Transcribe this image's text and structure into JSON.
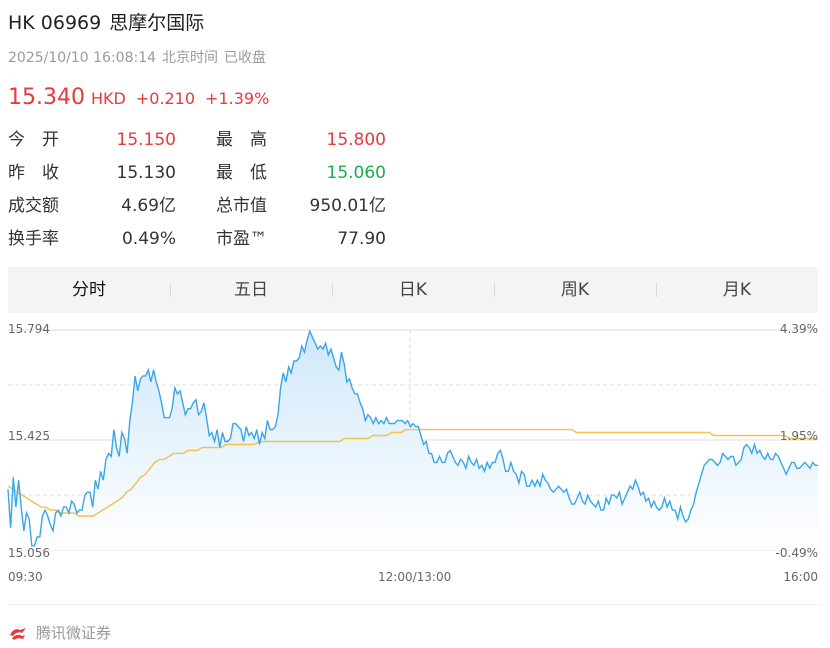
{
  "header": {
    "code": "HK 06969",
    "name": "思摩尔国际",
    "datetime": "2025/10/10 16:08:14",
    "timezone": "北京时间",
    "market_status": "已收盘"
  },
  "quote": {
    "price": "15.340",
    "currency": "HKD",
    "change": "+0.210",
    "change_pct": "+1.39%"
  },
  "stats": [
    {
      "label": "今　开",
      "value": "15.150",
      "tone": "red"
    },
    {
      "label": "最　高",
      "value": "15.800",
      "tone": "red"
    },
    {
      "label": "昨　收",
      "value": "15.130",
      "tone": "dark"
    },
    {
      "label": "最　低",
      "value": "15.060",
      "tone": "green"
    },
    {
      "label": "成交额",
      "value": "4.69亿",
      "tone": "dark"
    },
    {
      "label": "总市值",
      "value": "950.01亿",
      "tone": "dark"
    },
    {
      "label": "换手率",
      "value": "0.49%",
      "tone": "dark"
    },
    {
      "label": "市盈™",
      "value": "77.90",
      "tone": "dark"
    }
  ],
  "tabs": [
    {
      "label": "分时",
      "active": true
    },
    {
      "label": "五日",
      "active": false
    },
    {
      "label": "日K",
      "active": false
    },
    {
      "label": "周K",
      "active": false
    },
    {
      "label": "月K",
      "active": false
    }
  ],
  "chart_data": {
    "type": "area",
    "x_ticks": [
      "09:30",
      "12:00/13:00",
      "16:00"
    ],
    "y_left_ticks": [
      "15.794",
      "15.425",
      "15.056"
    ],
    "y_right_ticks": [
      "4.39%",
      "1.95%",
      "-0.49%"
    ],
    "ylim": [
      15.056,
      15.794
    ],
    "prev_close": 15.13,
    "grid": true,
    "colors": {
      "price_line": "#3aa6e8",
      "avg_line": "#f2c14e",
      "fill_top": "#cfe8fa",
      "grid": "#dddddd"
    },
    "series": [
      {
        "values": [
          15.26,
          15.13,
          15.3,
          15.2,
          15.29,
          15.2,
          15.12,
          15.18,
          15.16,
          15.07,
          15.07,
          15.1,
          15.1,
          15.17,
          15.19,
          15.17,
          15.14,
          15.12,
          15.18,
          15.19,
          15.17,
          15.2,
          15.2,
          15.18,
          15.22,
          15.21,
          15.18,
          15.19,
          15.19,
          15.24,
          15.25,
          15.25,
          15.2,
          15.29,
          15.26,
          15.32,
          15.29,
          15.36,
          15.38,
          15.37,
          15.46,
          15.4,
          15.37,
          15.45,
          15.43,
          15.38,
          15.49,
          15.55,
          15.64,
          15.59,
          15.63,
          15.64,
          15.64,
          15.66,
          15.62,
          15.66,
          15.62,
          15.59,
          15.55,
          15.5,
          15.5,
          15.5,
          15.53,
          15.6,
          15.58,
          15.59,
          15.55,
          15.51,
          15.53,
          15.53,
          15.55,
          15.56,
          15.51,
          15.52,
          15.55,
          15.5,
          15.44,
          15.45,
          15.42,
          15.46,
          15.4,
          15.45,
          15.42,
          15.42,
          15.43,
          15.48,
          15.48,
          15.47,
          15.46,
          15.42,
          15.47,
          15.44,
          15.45,
          15.43,
          15.46,
          15.41,
          15.45,
          15.43,
          15.49,
          15.46,
          15.46,
          15.47,
          15.51,
          15.6,
          15.65,
          15.62,
          15.67,
          15.65,
          15.69,
          15.69,
          15.7,
          15.74,
          15.72,
          15.76,
          15.79,
          15.77,
          15.75,
          15.73,
          15.74,
          15.73,
          15.75,
          15.71,
          15.73,
          15.7,
          15.67,
          15.66,
          15.72,
          15.68,
          15.62,
          15.63,
          15.6,
          15.58,
          15.58,
          15.55,
          15.53,
          15.49,
          15.51,
          15.5,
          15.48,
          15.5,
          15.48,
          15.49,
          15.48,
          15.5,
          15.48,
          15.48,
          15.48,
          15.49,
          15.49,
          15.49,
          15.48,
          15.49,
          15.47,
          15.48,
          15.47,
          15.47,
          15.44,
          15.41,
          15.42,
          15.38,
          15.38,
          15.35,
          15.35,
          15.37,
          15.35,
          15.35,
          15.38,
          15.39,
          15.37,
          15.35,
          15.34,
          15.36,
          15.35,
          15.33,
          15.37,
          15.35,
          15.34,
          15.36,
          15.33,
          15.34,
          15.32,
          15.35,
          15.33,
          15.35,
          15.35,
          15.38,
          15.39,
          15.36,
          15.32,
          15.32,
          15.35,
          15.32,
          15.31,
          15.28,
          15.32,
          15.31,
          15.27,
          15.27,
          15.29,
          15.27,
          15.29,
          15.27,
          15.31,
          15.29,
          15.28,
          15.26,
          15.25,
          15.26,
          15.27,
          15.26,
          15.25,
          15.26,
          15.23,
          15.21,
          15.21,
          15.23,
          15.25,
          15.22,
          15.21,
          15.24,
          15.22,
          15.21,
          15.2,
          15.22,
          15.19,
          15.19,
          15.23,
          15.21,
          15.24,
          15.24,
          15.23,
          15.25,
          15.21,
          15.23,
          15.25,
          15.27,
          15.26,
          15.29,
          15.27,
          15.24,
          15.25,
          15.22,
          15.23,
          15.2,
          15.22,
          15.2,
          15.19,
          15.2,
          15.23,
          15.2,
          15.22,
          15.19,
          15.19,
          15.16,
          15.2,
          15.17,
          15.15,
          15.16,
          15.19,
          15.21,
          15.25,
          15.28,
          15.31,
          15.34,
          15.35,
          15.36,
          15.36,
          15.35,
          15.34,
          15.35,
          15.38,
          15.37,
          15.36,
          15.37,
          15.37,
          15.34,
          15.35,
          15.36,
          15.4,
          15.41,
          15.4,
          15.38,
          15.41,
          15.38,
          15.39,
          15.37,
          15.36,
          15.38,
          15.36,
          15.36,
          15.38,
          15.37,
          15.35,
          15.33,
          15.31,
          15.33,
          15.35,
          15.35,
          15.33,
          15.33,
          15.34,
          15.35,
          15.34,
          15.33,
          15.35,
          15.34,
          15.34
        ]
      },
      {
        "values": [
          15.27,
          15.26,
          15.25,
          15.24,
          15.23,
          15.22,
          15.21,
          15.2,
          15.2,
          15.19,
          15.19,
          15.18,
          15.18,
          15.18,
          15.18,
          15.17,
          15.17,
          15.17,
          15.17,
          15.18,
          15.19,
          15.2,
          15.21,
          15.22,
          15.23,
          15.25,
          15.26,
          15.28,
          15.3,
          15.31,
          15.33,
          15.35,
          15.36,
          15.36,
          15.37,
          15.38,
          15.38,
          15.38,
          15.39,
          15.39,
          15.39,
          15.4,
          15.4,
          15.4,
          15.4,
          15.4,
          15.41,
          15.41,
          15.41,
          15.41,
          15.41,
          15.41,
          15.41,
          15.42,
          15.42,
          15.42,
          15.42,
          15.42,
          15.42,
          15.42,
          15.42,
          15.42,
          15.42,
          15.42,
          15.42,
          15.42,
          15.42,
          15.42,
          15.42,
          15.42,
          15.42,
          15.43,
          15.43,
          15.43,
          15.43,
          15.43,
          15.43,
          15.44,
          15.44,
          15.44,
          15.44,
          15.45,
          15.45,
          15.45,
          15.46,
          15.46,
          15.46,
          15.46,
          15.46,
          15.46,
          15.46,
          15.46,
          15.46,
          15.46,
          15.46,
          15.46,
          15.46,
          15.46,
          15.46,
          15.46,
          15.46,
          15.46,
          15.46,
          15.46,
          15.46,
          15.46,
          15.46,
          15.46,
          15.46,
          15.46,
          15.46,
          15.46,
          15.46,
          15.46,
          15.46,
          15.46,
          15.46,
          15.46,
          15.46,
          15.46,
          15.45,
          15.45,
          15.45,
          15.45,
          15.45,
          15.45,
          15.45,
          15.45,
          15.45,
          15.45,
          15.45,
          15.45,
          15.45,
          15.45,
          15.45,
          15.45,
          15.45,
          15.45,
          15.45,
          15.45,
          15.45,
          15.45,
          15.45,
          15.45,
          15.45,
          15.45,
          15.45,
          15.45,
          15.45,
          15.44,
          15.44,
          15.44,
          15.44,
          15.44,
          15.44,
          15.44,
          15.44,
          15.44,
          15.44,
          15.44,
          15.44,
          15.44,
          15.44,
          15.44,
          15.44,
          15.43,
          15.43,
          15.43,
          15.43,
          15.43,
          15.43,
          15.43
        ]
      }
    ]
  },
  "footer": {
    "brand": "腾讯微证券",
    "logo_icon": "tencent-securities-logo-icon",
    "logo_color": "#e9393c"
  }
}
